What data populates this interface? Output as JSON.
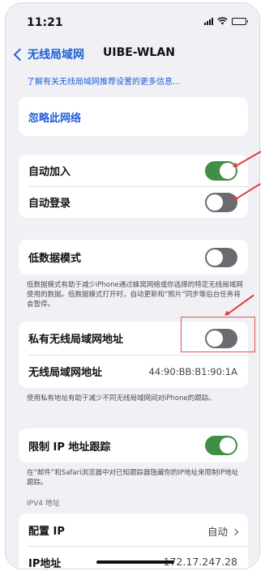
{
  "status": {
    "time": "11:21"
  },
  "nav": {
    "back_label": "无线局域网",
    "title": "UIBE-WLAN"
  },
  "info_link": "了解有关无线局域网推荐设置的更多信息...",
  "forget": {
    "label": "忽略此网络"
  },
  "auto": {
    "join_label": "自动加入",
    "join_on": true,
    "login_label": "自动登录",
    "login_on": false
  },
  "low_data": {
    "label": "低数据模式",
    "on": false,
    "footer": "低数据模式有助于减少iPhone通过蜂窝网络或你选择的特定无线局域网使用的数据。低数据模式打开时，自动更新和“照片”同步等后台任务将会暂停。"
  },
  "private": {
    "label": "私有无线局域网地址",
    "on": false,
    "mac_label": "无线局域网地址",
    "mac_value": "44:90:BB:B1:90:1A",
    "footer": "使用私有地址有助于减少不同无线局域网间对iPhone的跟踪。"
  },
  "limit_ip": {
    "label": "限制 IP 地址跟踪",
    "on": true,
    "footer": "在“邮件”和Safari浏览器中对已知跟踪器隐藏你的IP地址来限制IP地址跟踪。"
  },
  "ipv4": {
    "header": "IPV4 地址",
    "config_label": "配置 IP",
    "config_value": "自动",
    "ip_label": "IP地址",
    "ip_value": "172.17.247.28"
  },
  "colors": {
    "accent": "#1d5fd8",
    "toggle_on": "#3f8f45",
    "annotation": "#e23b3b"
  }
}
